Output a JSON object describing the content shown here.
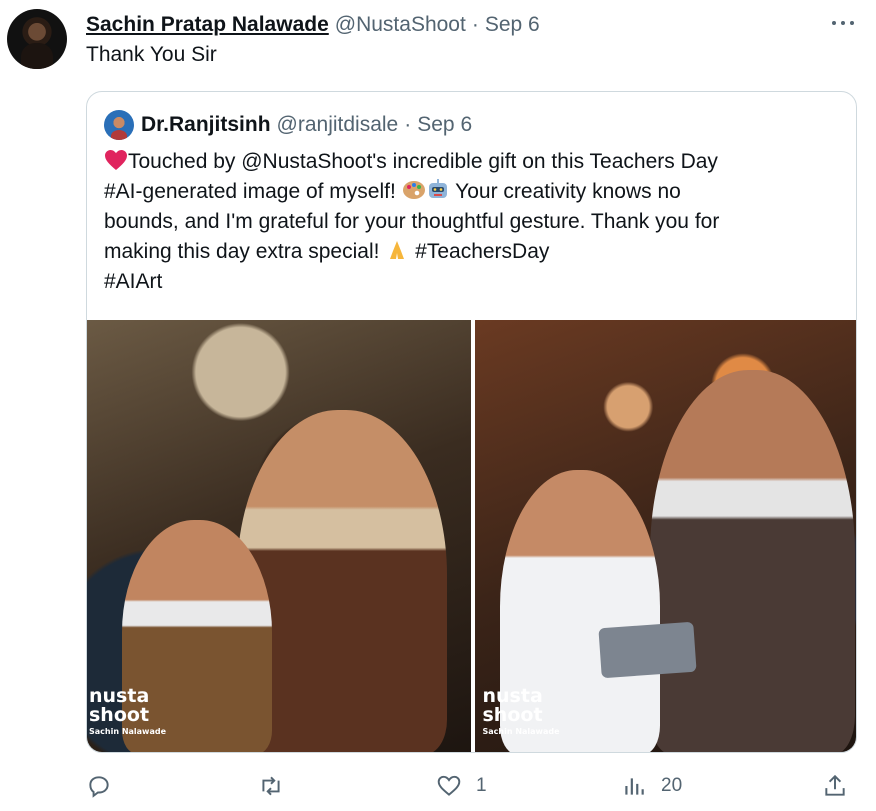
{
  "tweet": {
    "author_name": "Sachin Pratap Nalawade",
    "author_handle": "@NustaShoot",
    "separator": "·",
    "date": "Sep 6",
    "text": "Thank You Sir"
  },
  "quoted_tweet": {
    "author_name": "Dr.Ranjitsinh",
    "author_handle": "@ranjitdisale",
    "separator": "·",
    "date": "Sep 6",
    "lines": {
      "l1": "Touched by  @NustaShoot's incredible gift on this Teachers Day",
      "l2": "#AI-generated image of myself!",
      "l2b": "Your creativity knows no",
      "l3": "bounds, and I'm grateful for your thoughtful gesture. Thank you for",
      "l4": "making this day extra special!",
      "l4b": "#TeachersDay",
      "l5": " #AIArt"
    },
    "images": [
      {
        "watermark_line1": "nusta",
        "watermark_line2": "shoot",
        "watermark_line3": "Sachin Nalawade"
      },
      {
        "watermark_line1": "nusta",
        "watermark_line2": "shoot",
        "watermark_line3": "Sachin Nalawade"
      }
    ]
  },
  "actions": {
    "reply": {
      "icon": "reply-icon",
      "count": ""
    },
    "retweet": {
      "icon": "retweet-icon",
      "count": ""
    },
    "like": {
      "icon": "heart-icon",
      "count": "1"
    },
    "views": {
      "icon": "views-icon",
      "count": "20"
    },
    "share": {
      "icon": "share-icon",
      "count": ""
    }
  },
  "colors": {
    "text_primary": "#0f1419",
    "text_secondary": "#536471",
    "border": "#cfd9de",
    "heart_emoji": "#e0245e"
  }
}
